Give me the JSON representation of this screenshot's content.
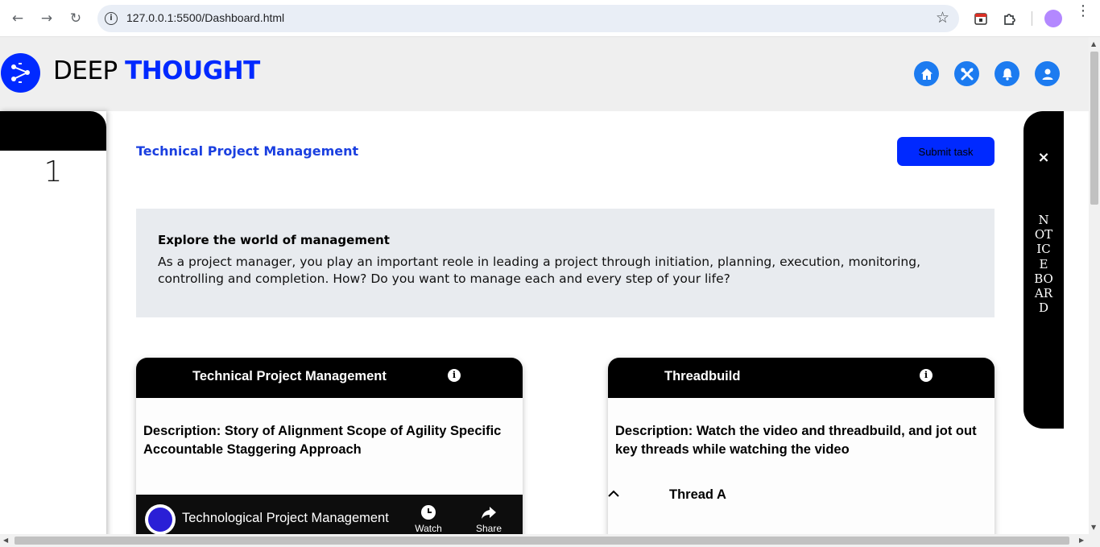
{
  "browser": {
    "url": "127.0.0.1:5500/Dashboard.html"
  },
  "header": {
    "brand_light": "DEEP ",
    "brand_bold": "THOUGHT",
    "icons": [
      "home-icon",
      "tools-icon",
      "bell-icon",
      "user-icon"
    ]
  },
  "left_panel": {
    "number": "1"
  },
  "main": {
    "title": "Technical Project Management",
    "submit_label": "Submit task",
    "intro": {
      "heading": "Explore the world of management",
      "text": "As a project manager, you play an important reole in leading a project through initiation, planning, execution, monitoring, controlling and completion. How? Do you want to manage each and every step of your life?"
    },
    "cards": [
      {
        "title": "Technical Project Management",
        "desc_label": "Description:",
        "desc_text": " Story of Alignment Scope of Agility Specific Accountable Staggering Approach",
        "video": {
          "title": "Technological Project Management",
          "watch_later": "Watch Later",
          "share": "Share"
        }
      },
      {
        "title": "Threadbuild",
        "desc_label": "Description:",
        "desc_text": " Watch the video and threadbuild, and jot out key threads while watching the video",
        "thread": "Thread A"
      }
    ]
  },
  "notice_board": {
    "close": "×",
    "label": "NOTICE BOARD"
  },
  "colors": {
    "brand_blue": "#0029ff",
    "icon_blue": "#1c7bf0",
    "title_blue": "#1a3fe0"
  }
}
